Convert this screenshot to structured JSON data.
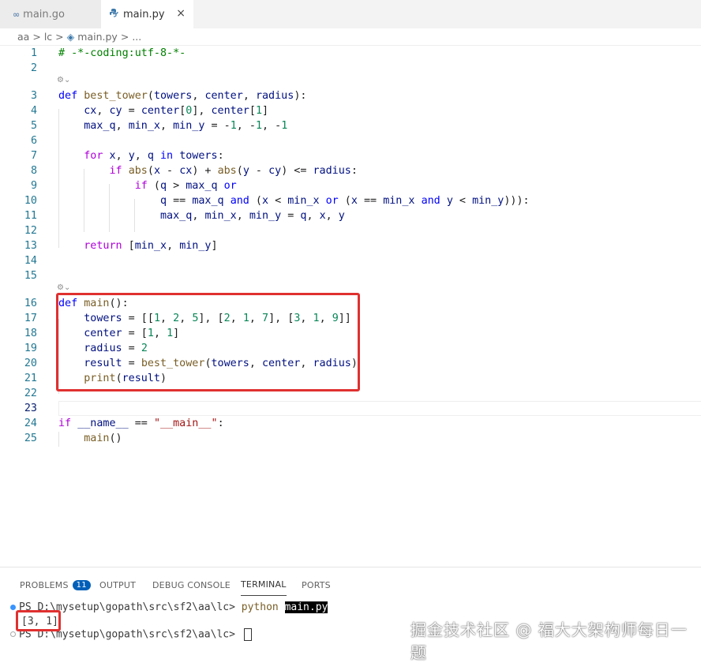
{
  "tabs": [
    {
      "label": "main.go",
      "icon": "go-icon",
      "active": false
    },
    {
      "label": "main.py",
      "icon": "python-icon",
      "active": true,
      "close": "×"
    }
  ],
  "breadcrumb": {
    "folder1": "aa",
    "sep": ">",
    "folder2": "lc",
    "file": "main.py",
    "more": "..."
  },
  "code": {
    "l1": "1",
    "l2": "2",
    "l3": "3",
    "l4": "4",
    "l5": "5",
    "l6": "6",
    "l7": "7",
    "l8": "8",
    "l9": "9",
    "l10": "10",
    "l11": "11",
    "l12": "12",
    "l13": "13",
    "l14": "14",
    "l15": "15",
    "l16": "16",
    "l17": "17",
    "l18": "18",
    "l19": "19",
    "l20": "20",
    "l21": "21",
    "l22": "22",
    "l23": "23",
    "l24": "24",
    "l25": "25"
  },
  "panel": {
    "tabs": {
      "problems": "PROBLEMS",
      "problems_count": "11",
      "output": "OUTPUT",
      "debug": "DEBUG CONSOLE",
      "terminal": "TERMINAL",
      "ports": "PORTS"
    },
    "line1_prompt": "PS D:\\mysetup\\gopath\\src\\sf2\\aa\\lc>",
    "line1_cmd": "python",
    "line1_arg": "main.py",
    "line2_output": "[3, 1]",
    "line3_prompt": "PS D:\\mysetup\\gopath\\src\\sf2\\aa\\lc>"
  },
  "watermark": "掘金技术社区 @ 福大大架构师每日一题"
}
